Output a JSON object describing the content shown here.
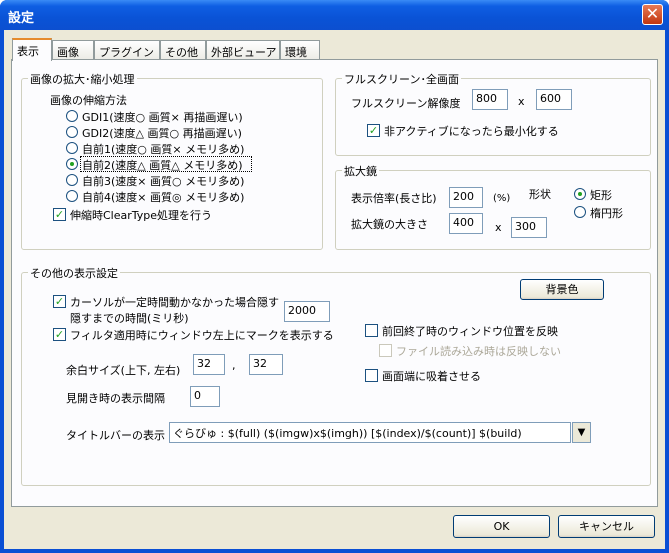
{
  "window": {
    "title": "設定",
    "close_icon": "close-icon"
  },
  "tabs": [
    {
      "label": "表示",
      "active": true
    },
    {
      "label": "画像"
    },
    {
      "label": "プラグイン"
    },
    {
      "label": "その他"
    },
    {
      "label": "外部ビューア"
    },
    {
      "label": "環境"
    }
  ],
  "scaling": {
    "group_title": "画像の拡大･縮小処理",
    "method_title": "画像の伸縮方法",
    "options": [
      "GDI1(速度○ 画質× 再描画遅い)",
      "GDI2(速度△ 画質○ 再描画遅い)",
      "自前1(速度○ 画質× メモリ多め)",
      "自前2(速度△ 画質△ メモリ多め)",
      "自前3(速度× 画質○ メモリ多め)",
      "自前4(速度× 画質◎ メモリ多め)"
    ],
    "selected_index": 3,
    "cleartype_label": "伸縮時ClearType処理を行う",
    "cleartype_checked": true
  },
  "fullscreen": {
    "group_title": "フルスクリーン･全画面",
    "resolution_label": "フルスクリーン解像度",
    "width": "800",
    "x_sep": "x",
    "height": "600",
    "minimize_label": "非アクティブになったら最小化する",
    "minimize_checked": true
  },
  "magnifier": {
    "group_title": "拡大鏡",
    "zoom_label": "表示倍率(長さ比)",
    "zoom_value": "200",
    "zoom_unit": "(%)",
    "shape_label": "形状",
    "shape_rect": "矩形",
    "shape_ellipse": "楕円形",
    "shape_selected": "rect",
    "size_label": "拡大鏡の大きさ",
    "size_w": "400",
    "x_sep": "x",
    "size_h": "300"
  },
  "other": {
    "group_title": "その他の表示設定",
    "hide_cursor_label": "カーソルが一定時間動かなかった場合隠す",
    "hide_cursor_checked": true,
    "hide_time_label": "隠すまでの時間(ミリ秒)",
    "hide_time_value": "2000",
    "filter_mark_label": "フィルタ適用時にウィンドウ左上にマークを表示する",
    "filter_mark_checked": true,
    "margin_label": "余白サイズ(上下, 左右)",
    "margin_v": "32",
    "comma": ",",
    "margin_h": "32",
    "spread_label": "見開き時の表示間隔",
    "spread_value": "0",
    "titlebar_label": "タイトルバーの表示",
    "titlebar_value": "ぐらびゅ : $(full) ($(imgw)x$(imgh)) [$(index)/$(count)] $(build)",
    "bgcolor_button": "背景色",
    "restore_pos_label": "前回終了時のウィンドウ位置を反映",
    "restore_pos_checked": false,
    "no_restore_on_file_label": "ファイル読み込み時は反映しない",
    "snap_edge_label": "画面端に吸着させる",
    "snap_edge_checked": false
  },
  "footer": {
    "ok": "OK",
    "cancel": "キャンセル"
  }
}
